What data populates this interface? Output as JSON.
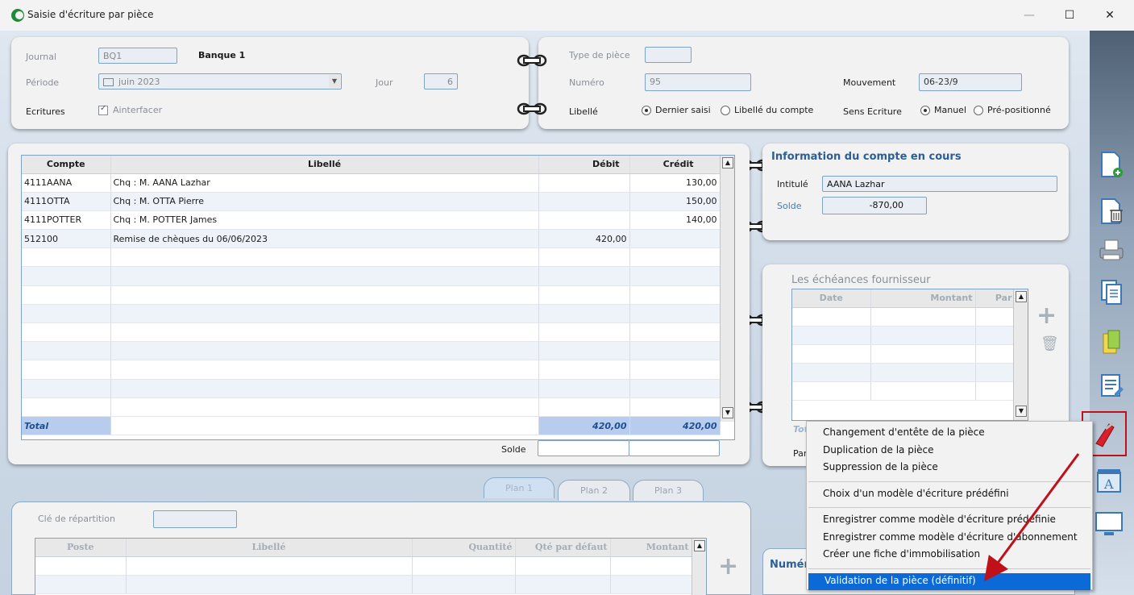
{
  "window": {
    "title": "Saisie d'écriture par pièce"
  },
  "header_left": {
    "journal_label": "Journal",
    "journal_code": "BQ1",
    "journal_name": "Banque 1",
    "periode_label": "Période",
    "periode_value": "juin 2023",
    "jour_label": "Jour",
    "jour_value": "6",
    "ecritures_label": "Ecritures",
    "ainterfacer_label": "Ainterfacer"
  },
  "header_right": {
    "type_piece_label": "Type de pièce",
    "type_piece_value": "",
    "numero_label": "Numéro",
    "numero_value": "95",
    "mouvement_label": "Mouvement",
    "mouvement_value": "06-23/9",
    "libelle_label": "Libellé",
    "dernier_saisi": "Dernier saisi",
    "libelle_compte": "Libellé du compte",
    "sens_label": "Sens Ecriture",
    "manuel": "Manuel",
    "prepositionne": "Pré-positionné"
  },
  "entries": {
    "headers": {
      "compte": "Compte",
      "libelle": "Libellé",
      "debit": "Débit",
      "credit": "Crédit"
    },
    "rows": [
      {
        "compte": "4111AANA",
        "libelle": "Chq : M. AANA Lazhar",
        "debit": "",
        "credit": "130,00"
      },
      {
        "compte": "4111OTTA",
        "libelle": "Chq : M. OTTA Pierre",
        "debit": "",
        "credit": "150,00"
      },
      {
        "compte": "4111POTTER",
        "libelle": "Chq : M. POTTER James",
        "debit": "",
        "credit": "140,00"
      },
      {
        "compte": "512100",
        "libelle": "Remise de chèques du 06/06/2023",
        "debit": "420,00",
        "credit": ""
      }
    ],
    "total_label": "Total",
    "total_debit": "420,00",
    "total_credit": "420,00",
    "solde_label": "Solde"
  },
  "account_info": {
    "title": "Information du compte en cours",
    "intitule_label": "Intitulé",
    "intitule_value": "AANA Lazhar",
    "solde_label": "Solde",
    "solde_value": "-870,00"
  },
  "echeances": {
    "title": "Les échéances fournisseur",
    "headers": {
      "date": "Date",
      "montant": "Montant",
      "par": "Par"
    },
    "total_partial": "Tot",
    "par_partial": "Par"
  },
  "tabs": [
    "Plan 1",
    "Plan 2",
    "Plan 3"
  ],
  "analytic": {
    "cle_label": "Clé de répartition",
    "headers": {
      "poste": "Poste",
      "libelle": "Libellé",
      "quantite": "Quantité",
      "qte_defaut": "Qté par défaut",
      "montant": "Montant"
    },
    "numero_partial": "Numér"
  },
  "context_menu": {
    "group1": [
      "Changement d'entête de la pièce",
      "Duplication de la pièce",
      "Suppression de la pièce"
    ],
    "group2": [
      "Choix d'un modèle d'écriture prédéfini"
    ],
    "group3": [
      "Enregistrer comme modèle d'écriture prédéfinie",
      "Enregistrer comme modèle d'écriture d'abonnement",
      "Créer une fiche d'immobilisation"
    ],
    "group4": [
      "Validation de la pièce (définitif)"
    ]
  },
  "colors": {
    "accent": "#0b6ad8",
    "highlight_box": "#c0101a",
    "arrow": "#c0101a",
    "total_row": "#b8cdee"
  }
}
